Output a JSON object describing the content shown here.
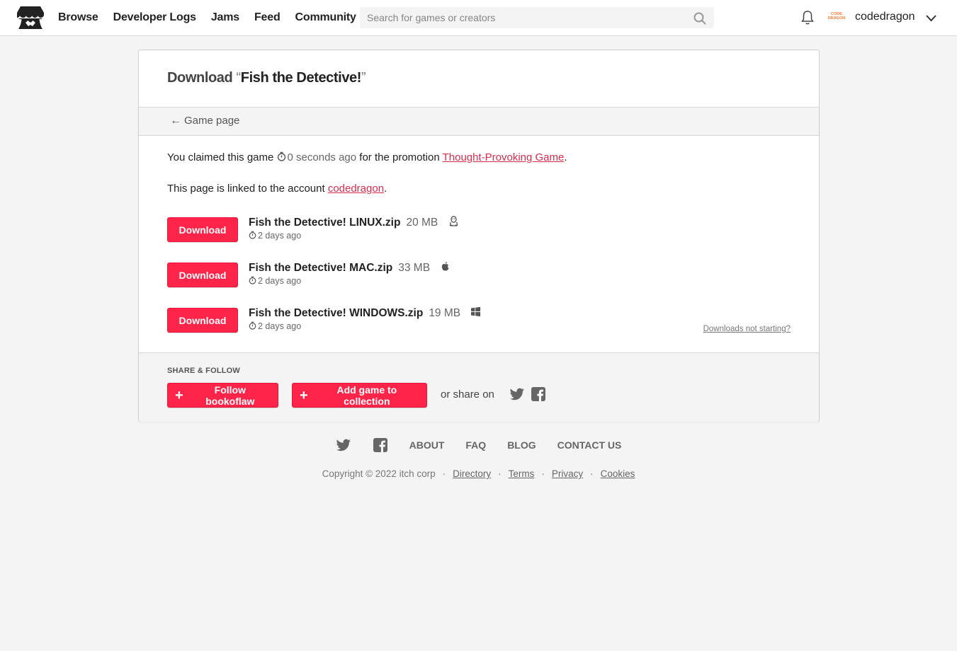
{
  "header": {
    "nav": [
      "Browse",
      "Developer Logs",
      "Jams",
      "Feed",
      "Community"
    ],
    "search_placeholder": "Search for games or creators",
    "avatar_text": "CODE DRAGON",
    "username": "codedragon"
  },
  "page": {
    "title_prefix": "Download",
    "open_quote": "“",
    "game_name": "Fish the Detective!",
    "close_quote": "”",
    "back_label": "Game page",
    "claim_prefix": "You claimed this game",
    "claim_ago": "0 seconds ago",
    "claim_middle": "for the promotion",
    "promotion": "Thought-Provoking Game",
    "claim_suffix": ".",
    "account_prefix": "This page is linked to the account",
    "account": "codedragon",
    "account_suffix": "."
  },
  "uploads": [
    {
      "button": "Download",
      "name": "Fish the Detective! LINUX.zip",
      "size": "20 MB",
      "platform": "linux-icon",
      "date": "2 days ago"
    },
    {
      "button": "Download",
      "name": "Fish the Detective! MAC.zip",
      "size": "33 MB",
      "platform": "apple-icon",
      "date": "2 days ago"
    },
    {
      "button": "Download",
      "name": "Fish the Detective! WINDOWS.zip",
      "size": "19 MB",
      "platform": "windows-icon",
      "date": "2 days ago"
    }
  ],
  "downloads_not_starting": "Downloads not starting?",
  "share": {
    "title": "SHARE & FOLLOW",
    "follow_label": "Follow bookoflaw",
    "collection_label": "Add game to collection",
    "or_share": "or share on"
  },
  "footer": {
    "links": [
      "ABOUT",
      "FAQ",
      "BLOG",
      "CONTACT US"
    ],
    "copyright": "Copyright © 2022 itch corp",
    "legal": [
      "Directory",
      "Terms",
      "Privacy",
      "Cookies"
    ]
  },
  "colors": {
    "accent": "#ff2449",
    "link": "#da2c4d",
    "bg": "#f4f4f4"
  }
}
